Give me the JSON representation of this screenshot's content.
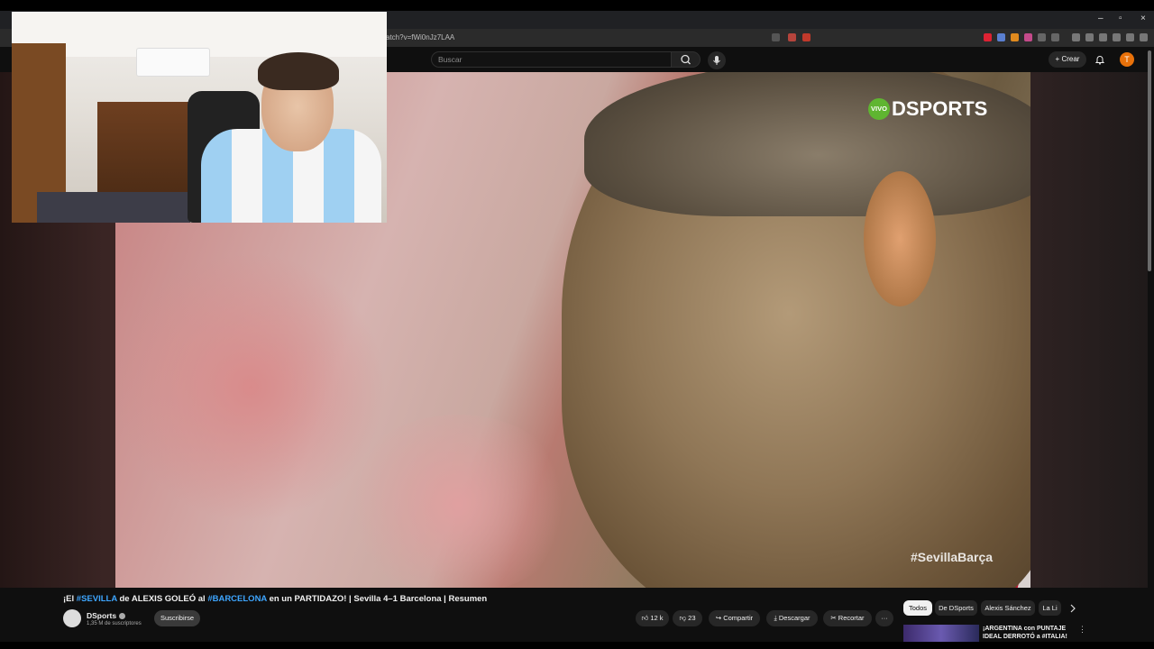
{
  "browser": {
    "url": "atch?v=fWi0nJz7LAA",
    "window_controls": [
      "–",
      "▫",
      "×"
    ]
  },
  "youtube_header": {
    "search_placeholder": "Buscar",
    "create_label": "Crear",
    "avatar_letter": "T"
  },
  "video": {
    "logo_vivo": "VIVO",
    "logo_brand": "DSPORTS",
    "hashtag": "#SevillaBarça"
  },
  "title": {
    "part1": "¡El ",
    "tag1": "#SEVILLA",
    "part2": " de ALEXIS GOLEÓ al ",
    "tag2": "#BARCELONA",
    "part3": " en un PARTIDAZO! | Sevilla 4–1 Barcelona | Resumen"
  },
  "channel": {
    "name": "DSports",
    "subscribers": "1,35 M de suscriptores",
    "subscribe_label": "Suscribirse"
  },
  "actions": {
    "likes": "12 k",
    "dislikes": "23",
    "share": "Compartir",
    "download": "Descargar",
    "clip": "Recortar",
    "more": "···"
  },
  "chips": [
    "Todos",
    "De DSports",
    "Alexis Sánchez",
    "La Li"
  ],
  "recommendation": {
    "title": "¡ARGENTINA con PUNTAJE IDEAL DERROTÓ a #ITALIA!",
    "menu": "⋮"
  },
  "colors": {
    "accent_link": "#3ea6ff",
    "avatar_bg": "#e8710a",
    "vivo_green": "#5fb531"
  }
}
